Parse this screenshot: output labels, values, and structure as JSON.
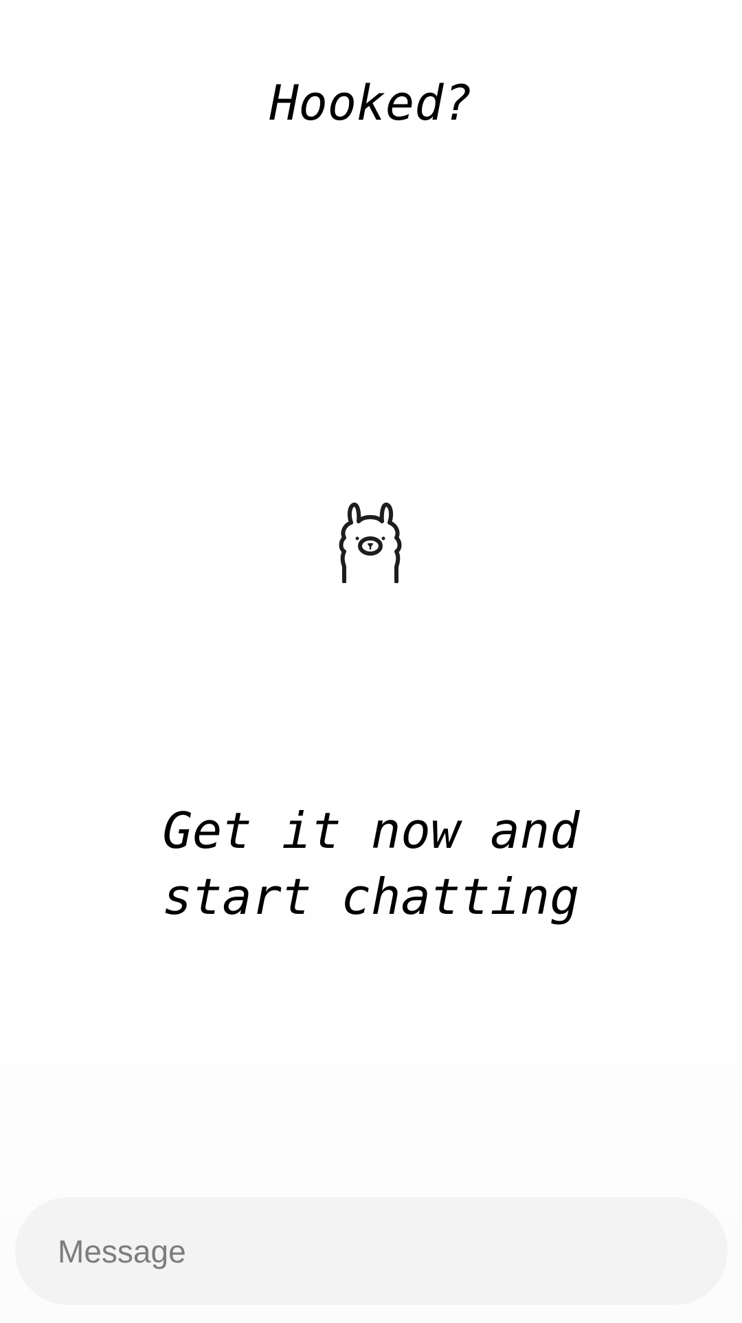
{
  "onboarding": {
    "headline": "Hooked?",
    "tagline_line1": "Get it now and",
    "tagline_line2": "start chatting",
    "mascot_icon": "llama-icon"
  },
  "composer": {
    "placeholder": "Message",
    "value": ""
  },
  "colors": {
    "background": "#ffffff",
    "text": "#000000",
    "composer_bg": "#f3f3f3",
    "placeholder": "#7d7d7d"
  }
}
